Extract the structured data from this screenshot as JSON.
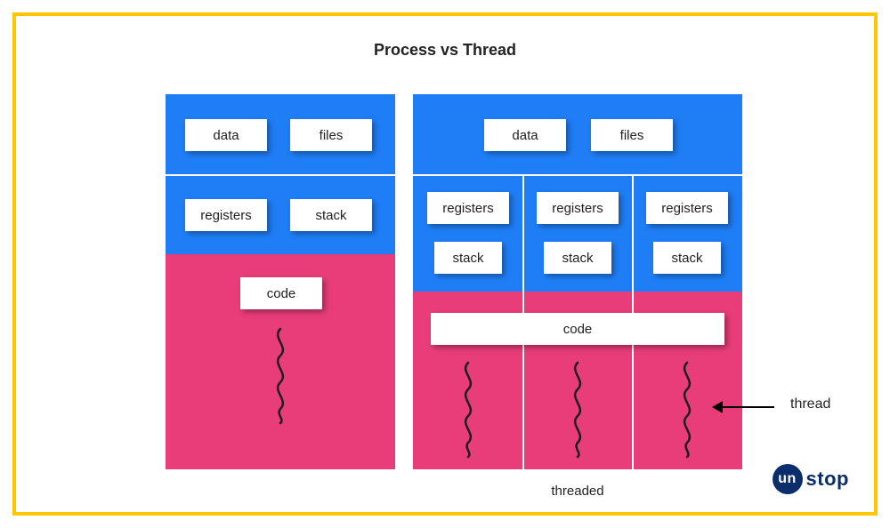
{
  "title": "Process vs Thread",
  "process": {
    "data": "data",
    "files": "files",
    "registers": "registers",
    "stack": "stack",
    "code": "code"
  },
  "threaded": {
    "data": "data",
    "files": "files",
    "threads": [
      {
        "registers": "registers",
        "stack": "stack"
      },
      {
        "registers": "registers",
        "stack": "stack"
      },
      {
        "registers": "registers",
        "stack": "stack"
      }
    ],
    "code": "code",
    "caption": "threaded"
  },
  "annotation": "thread",
  "logo": {
    "badge": "un",
    "rest": "stop"
  },
  "colors": {
    "border": "#ffc700",
    "blue": "#1f7ef6",
    "pink": "#e83d78",
    "navy": "#0b2d6b"
  }
}
